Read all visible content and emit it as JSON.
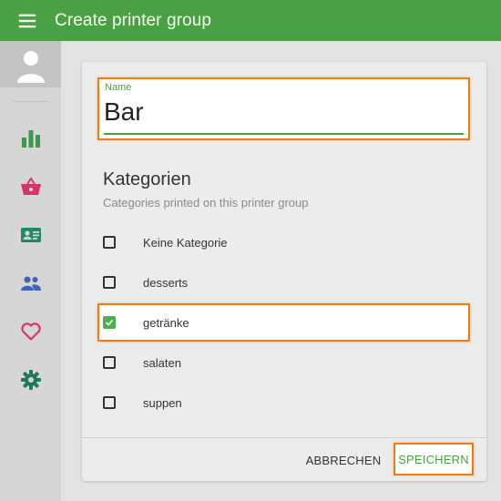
{
  "appbar": {
    "title": "Create printer group",
    "menu_icon": "menu-icon",
    "bg_color": "#4aa042"
  },
  "sidebar": {
    "items": [
      {
        "name": "chart",
        "icon": "bar-chart-icon",
        "color": "#3a9a4a"
      },
      {
        "name": "basket",
        "icon": "shopping-basket-icon",
        "color": "#d6336c"
      },
      {
        "name": "contact-card",
        "icon": "id-card-icon",
        "color": "#1f8a6a"
      },
      {
        "name": "users",
        "icon": "users-icon",
        "color": "#3f63b5"
      },
      {
        "name": "favorites",
        "icon": "heart-icon",
        "color": "#d6336c"
      },
      {
        "name": "settings",
        "icon": "gear-icon",
        "color": "#1f7a5a"
      }
    ]
  },
  "form": {
    "name_label": "Name",
    "name_value": "Bar",
    "section_title": "Kategorien",
    "section_subtitle": "Categories printed on this printer group",
    "categories": [
      {
        "label": "Keine Kategorie",
        "checked": false
      },
      {
        "label": "desserts",
        "checked": false
      },
      {
        "label": "getränke",
        "checked": true
      },
      {
        "label": "salaten",
        "checked": false
      },
      {
        "label": "suppen",
        "checked": false
      }
    ]
  },
  "actions": {
    "cancel_label": "ABBRECHEN",
    "save_label": "SPEICHERN"
  },
  "colors": {
    "accent": "#4aa042",
    "highlight": "#f27b12",
    "checkbox": "#4caf50"
  }
}
